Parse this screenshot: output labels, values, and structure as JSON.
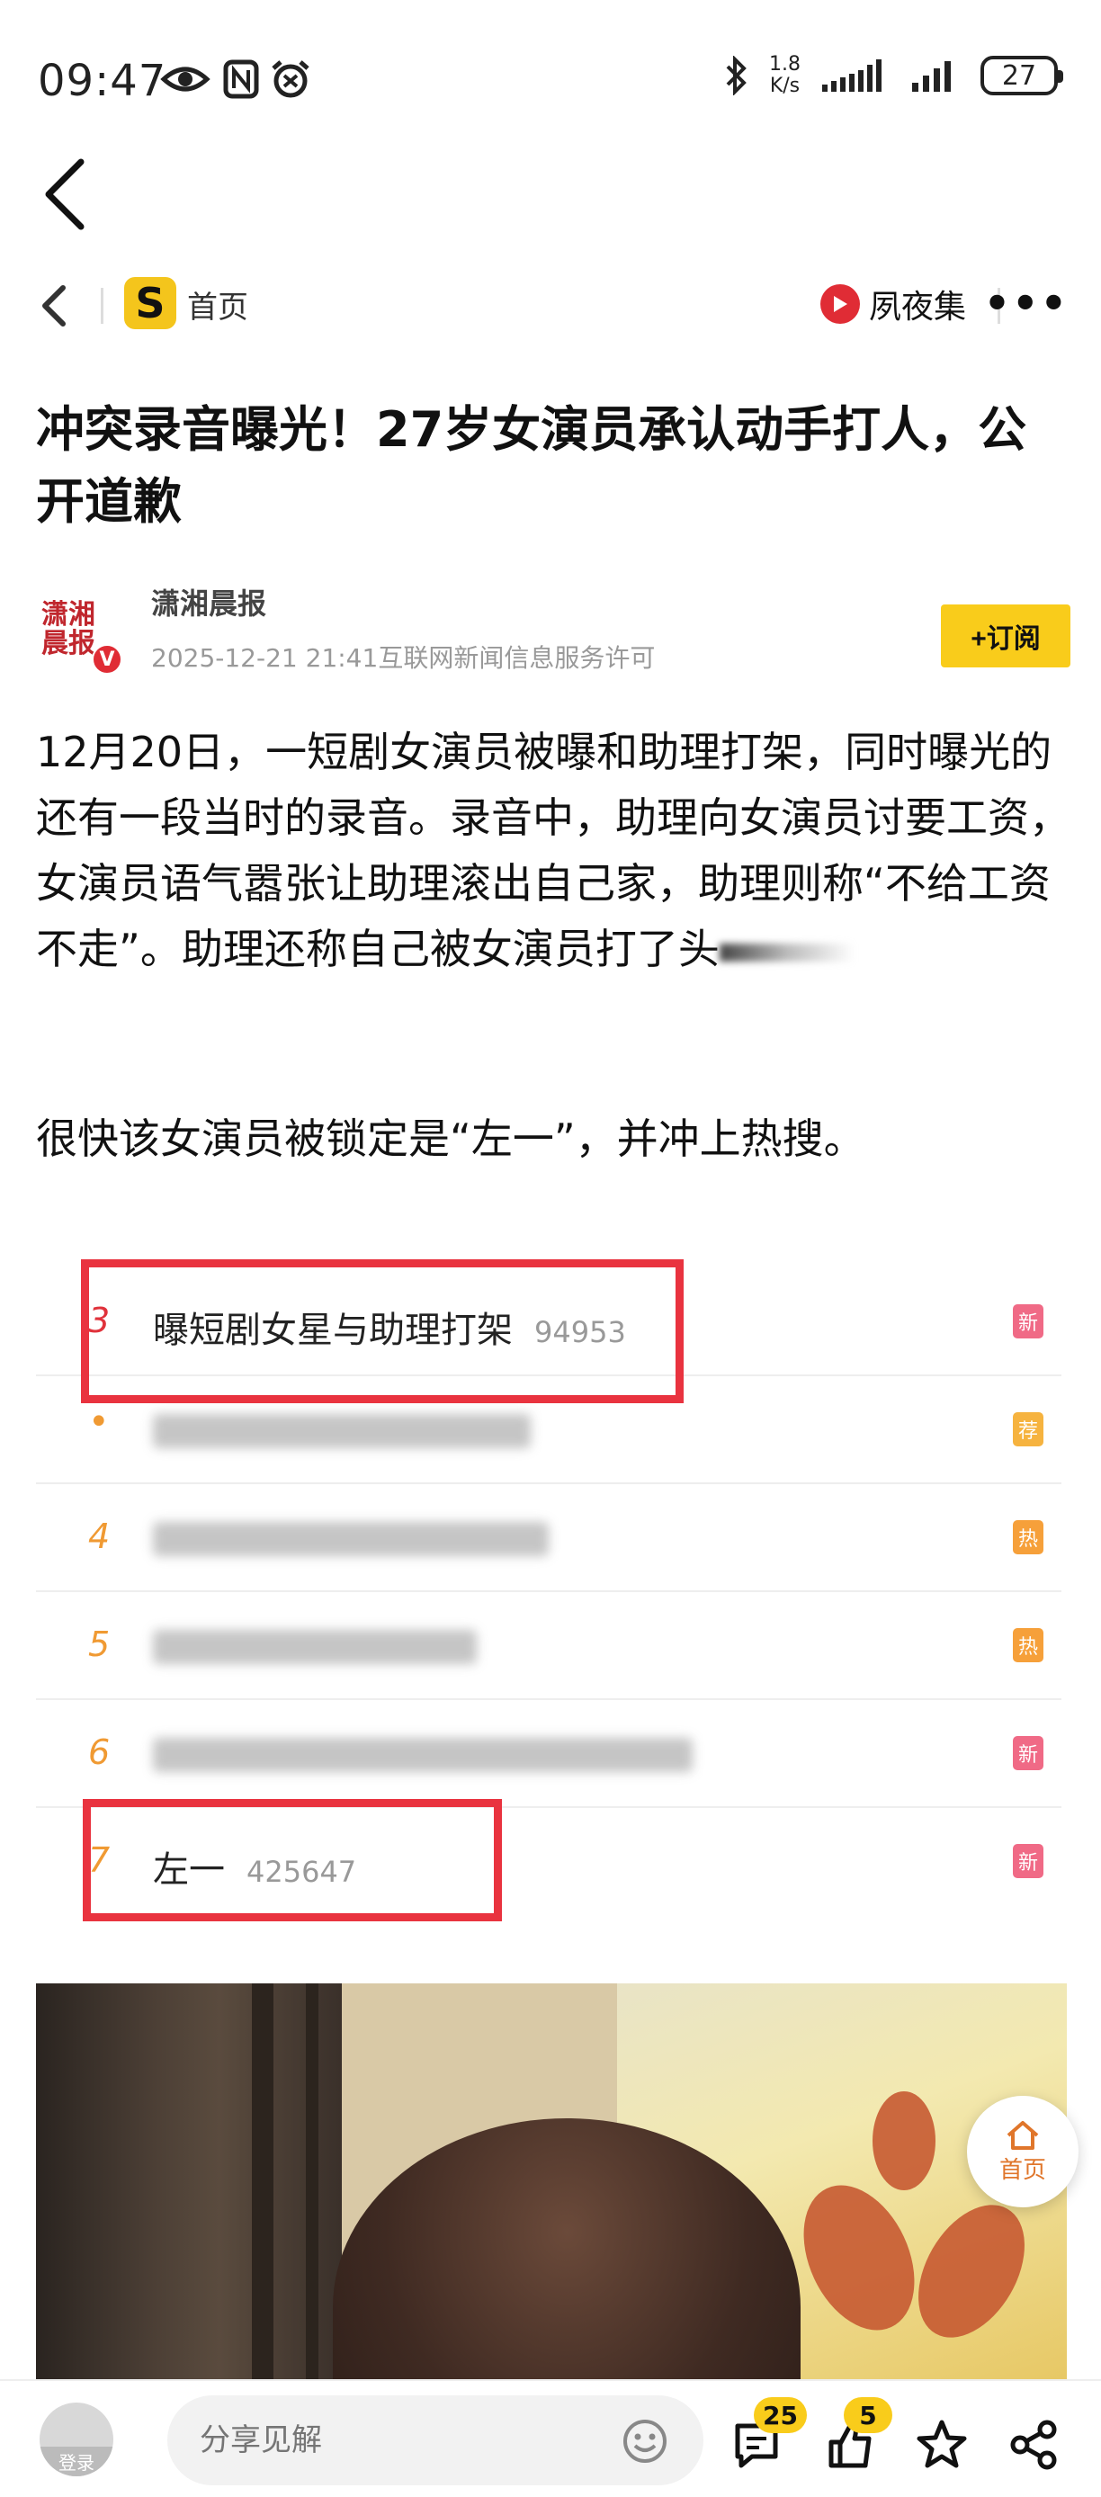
{
  "status_bar": {
    "time": "09:47",
    "speed_value": "1.8",
    "speed_unit": "K/s",
    "battery": "27"
  },
  "nav": {
    "home_label": "首页",
    "channel_label": "夙夜集"
  },
  "article": {
    "title": "冲突录音曝光！27岁女演员承认动手打人，公开道歉",
    "author_name": "潇湘晨报",
    "avatar_text": "潇湘晨报",
    "meta": "2025-12-21 21:41互联网新闻信息服务许可",
    "subscribe_label": "+订阅",
    "paragraph1": "12月20日，一短剧女演员被曝和助理打架，同时曝光的还有一段当时的录音。录音中，助理向女演员讨要工资，女演员语气嚣张让助理滚出自己家，助理则称“不给工资不走”。助理还称自己被女演员打了头",
    "paragraph2": "很快该女演员被锁定是“左一”，并冲上热搜。"
  },
  "hot_list": [
    {
      "rank": "3",
      "text": "曝短剧女星与助理打架",
      "count": "94953",
      "tag": "新",
      "tag_type": "new"
    },
    {
      "rank": "•",
      "text": "",
      "count": "",
      "tag": "荐",
      "tag_type": "rec"
    },
    {
      "rank": "4",
      "text": "",
      "count": "",
      "tag": "热",
      "tag_type": "hot"
    },
    {
      "rank": "5",
      "text": "",
      "count": "",
      "tag": "热",
      "tag_type": "hot"
    },
    {
      "rank": "6",
      "text": "",
      "count": "",
      "tag": "新",
      "tag_type": "new"
    },
    {
      "rank": "7",
      "text": "左一",
      "count": "425647",
      "tag": "新",
      "tag_type": "new"
    }
  ],
  "floating": {
    "home_label": "首页"
  },
  "bottom_bar": {
    "login_label": "登录",
    "comment_placeholder": "分享见解",
    "comment_count": "25",
    "share_count": "5"
  },
  "colors": {
    "accent_yellow": "#f9cc1b",
    "highlight_red": "#e9333f",
    "brand_red": "#e02c35"
  }
}
